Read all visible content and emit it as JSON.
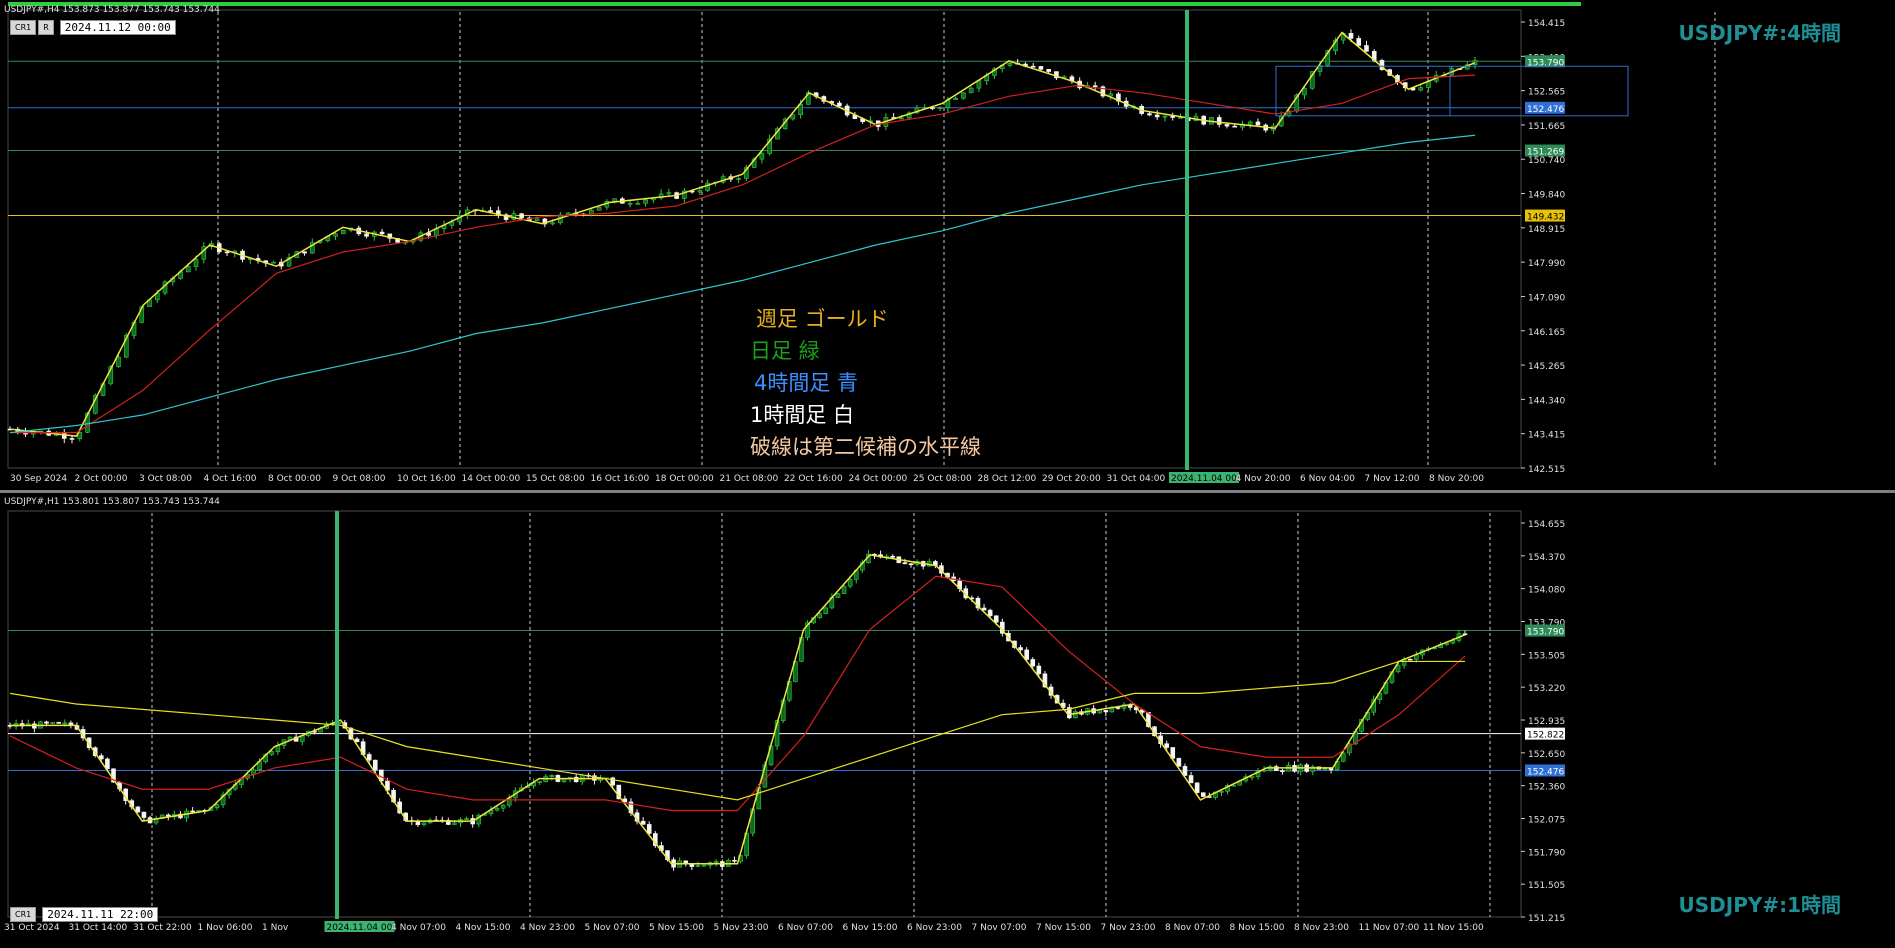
{
  "top_chart": {
    "info": "USDJPY#,H4  153.873 153.877 153.743 153.744",
    "buttons": [
      "CR1",
      "R"
    ],
    "date": "2024.11.12 00:00",
    "title": "USDJPY#:4時間",
    "notes": [
      {
        "text": "週足  ゴールド",
        "color": "#e8b020"
      },
      {
        "text": "日足  緑",
        "color": "#1aa01a"
      },
      {
        "text": "4時間足  青",
        "color": "#3d8fff"
      },
      {
        "text": "1時間足  白",
        "color": "#ffffff"
      },
      {
        "text": "破線は第二候補の水平線",
        "color": "#f4c7a0"
      }
    ],
    "price_labels": [
      "154.415",
      "153.490",
      "152.565",
      "151.665",
      "150.740",
      "149.840",
      "148.915",
      "147.990",
      "147.090",
      "146.165",
      "145.265",
      "144.340",
      "143.415",
      "142.515"
    ],
    "level_tags": [
      {
        "price": 153.79,
        "label": "153.790",
        "color": "#2e8b57"
      },
      {
        "price": 152.476,
        "label": "152.476",
        "color": "#2f6fd6"
      },
      {
        "price": 151.269,
        "label": "151.269",
        "color": "#2e8b57"
      },
      {
        "price": 149.432,
        "label": "149.432",
        "color": "#e8c20a"
      }
    ],
    "time_labels": [
      "30 Sep 2024",
      "2 Oct 00:00",
      "3 Oct 08:00",
      "4 Oct 16:00",
      "8 Oct 00:00",
      "9 Oct 08:00",
      "10 Oct 16:00",
      "14 Oct 00:00",
      "15 Oct 08:00",
      "16 Oct 16:00",
      "18 Oct 00:00",
      "21 Oct 08:00",
      "22 Oct 16:00",
      "24 Oct 00:00",
      "25 Oct 08:00",
      "28 Oct 12:00",
      "29 Oct 20:00",
      "31 Oct 04:00",
      "2024.11.04 00:00",
      "4 Nov 20:00",
      "6 Nov 04:00",
      "7 Nov 12:00",
      "8 Nov 20:00"
    ],
    "marker_label": "2024.11.04 00:00"
  },
  "bottom_chart": {
    "info": "USDJPY#,H1  153.801 153.807 153.743 153.744",
    "buttons": [
      "CR1"
    ],
    "date": "2024.11.11 22:00",
    "title": "USDJPY#:1時間",
    "price_labels": [
      "154.655",
      "154.370",
      "154.080",
      "153.790",
      "153.505",
      "153.220",
      "152.935",
      "152.650",
      "152.360",
      "152.075",
      "151.790",
      "151.505",
      "151.215"
    ],
    "level_tags": [
      {
        "price": 153.79,
        "label": "153.790",
        "color": "#2e8b57"
      },
      {
        "price": 152.822,
        "label": "152.822",
        "color": "#ffffff"
      },
      {
        "price": 152.476,
        "label": "152.476",
        "color": "#2f6fd6"
      }
    ],
    "time_labels": [
      "31 Oct 2024",
      "31 Oct 14:00",
      "31 Oct 22:00",
      "1 Nov 06:00",
      "1 Nov",
      "2024.11.04 00:00",
      "4 Nov 07:00",
      "4 Nov 15:00",
      "4 Nov 23:00",
      "5 Nov 07:00",
      "5 Nov 15:00",
      "5 Nov 23:00",
      "6 Nov 07:00",
      "6 Nov 15:00",
      "6 Nov 23:00",
      "7 Nov 07:00",
      "7 Nov 15:00",
      "7 Nov 23:00",
      "8 Nov 07:00",
      "8 Nov 15:00",
      "8 Nov 23:00",
      "11 Nov 07:00",
      "11 Nov 15:00"
    ],
    "marker_label": "2024.11.04 00:00"
  },
  "chart_data": [
    {
      "type": "line",
      "title": "USDJPY#:4時間",
      "ylim": [
        142.3,
        154.9
      ],
      "x": [
        "30 Sep 2024",
        "2 Oct 00:00",
        "3 Oct 08:00",
        "4 Oct 16:00",
        "8 Oct 00:00",
        "9 Oct 08:00",
        "10 Oct 16:00",
        "14 Oct 00:00",
        "15 Oct 08:00",
        "16 Oct 16:00",
        "18 Oct 00:00",
        "21 Oct 08:00",
        "22 Oct 16:00",
        "24 Oct 00:00",
        "25 Oct 08:00",
        "28 Oct 12:00",
        "29 Oct 20:00",
        "31 Oct 04:00",
        "2024.11.04 00:00",
        "4 Nov 20:00",
        "6 Nov 04:00",
        "7 Nov 12:00",
        "8 Nov 20:00"
      ],
      "series": [
        {
          "values": [
            143.4,
            143.2,
            146.9,
            148.6,
            148.0,
            149.1,
            148.7,
            149.6,
            149.2,
            149.8,
            150.0,
            150.6,
            152.9,
            152.0,
            152.6,
            153.8,
            153.2,
            152.4,
            152.1,
            151.9,
            154.6,
            153.0,
            153.75
          ]
        },
        {
          "values": [
            143.3,
            143.3,
            144.5,
            146.2,
            147.8,
            148.4,
            148.7,
            149.1,
            149.4,
            149.5,
            149.7,
            150.3,
            151.2,
            152.0,
            152.3,
            152.8,
            153.1,
            152.9,
            152.6,
            152.3,
            152.6,
            153.3,
            153.4
          ]
        },
        {
          "values": [
            143.3,
            143.5,
            143.8,
            144.3,
            144.8,
            145.2,
            145.6,
            146.1,
            146.4,
            146.8,
            147.2,
            147.6,
            148.1,
            148.6,
            149.0,
            149.5,
            149.9,
            150.3,
            150.6,
            150.9,
            151.2,
            151.5,
            151.7
          ]
        }
      ],
      "levels": [
        153.79,
        152.476,
        151.269,
        149.432
      ]
    },
    {
      "type": "line",
      "title": "USDJPY#:1時間",
      "ylim": [
        151.1,
        154.8
      ],
      "x": [
        "31 Oct 2024",
        "31 Oct 14:00",
        "31 Oct 22:00",
        "1 Nov 06:00",
        "1 Nov",
        "2024.11.04 00:00",
        "4 Nov 07:00",
        "4 Nov 15:00",
        "4 Nov 23:00",
        "5 Nov 07:00",
        "5 Nov 15:00",
        "5 Nov 23:00",
        "6 Nov 07:00",
        "6 Nov 15:00",
        "6 Nov 23:00",
        "7 Nov 07:00",
        "7 Nov 15:00",
        "7 Nov 23:00",
        "8 Nov 07:00",
        "8 Nov 15:00",
        "8 Nov 23:00",
        "11 Nov 07:00",
        "11 Nov 15:00"
      ],
      "series": [
        {
          "values": [
            152.9,
            152.9,
            152.0,
            152.1,
            152.7,
            152.95,
            152.0,
            152.0,
            152.4,
            152.4,
            151.6,
            151.6,
            153.8,
            154.5,
            154.4,
            153.8,
            153.0,
            153.1,
            152.2,
            152.5,
            152.5,
            153.5,
            153.75
          ]
        },
        {
          "values": [
            152.8,
            152.5,
            152.3,
            152.3,
            152.5,
            152.6,
            152.3,
            152.2,
            152.2,
            152.2,
            152.1,
            152.1,
            152.8,
            153.8,
            154.3,
            154.2,
            153.6,
            153.1,
            152.7,
            152.6,
            152.6,
            153.0,
            153.55
          ]
        },
        {
          "values": [
            153.2,
            153.1,
            153.05,
            153.0,
            152.95,
            152.9,
            152.7,
            152.6,
            152.5,
            152.4,
            152.3,
            152.2,
            152.4,
            152.6,
            152.8,
            153.0,
            153.05,
            153.2,
            153.2,
            153.25,
            153.3,
            153.5,
            153.5
          ]
        }
      ],
      "levels": [
        153.79,
        152.822,
        152.476
      ]
    }
  ]
}
